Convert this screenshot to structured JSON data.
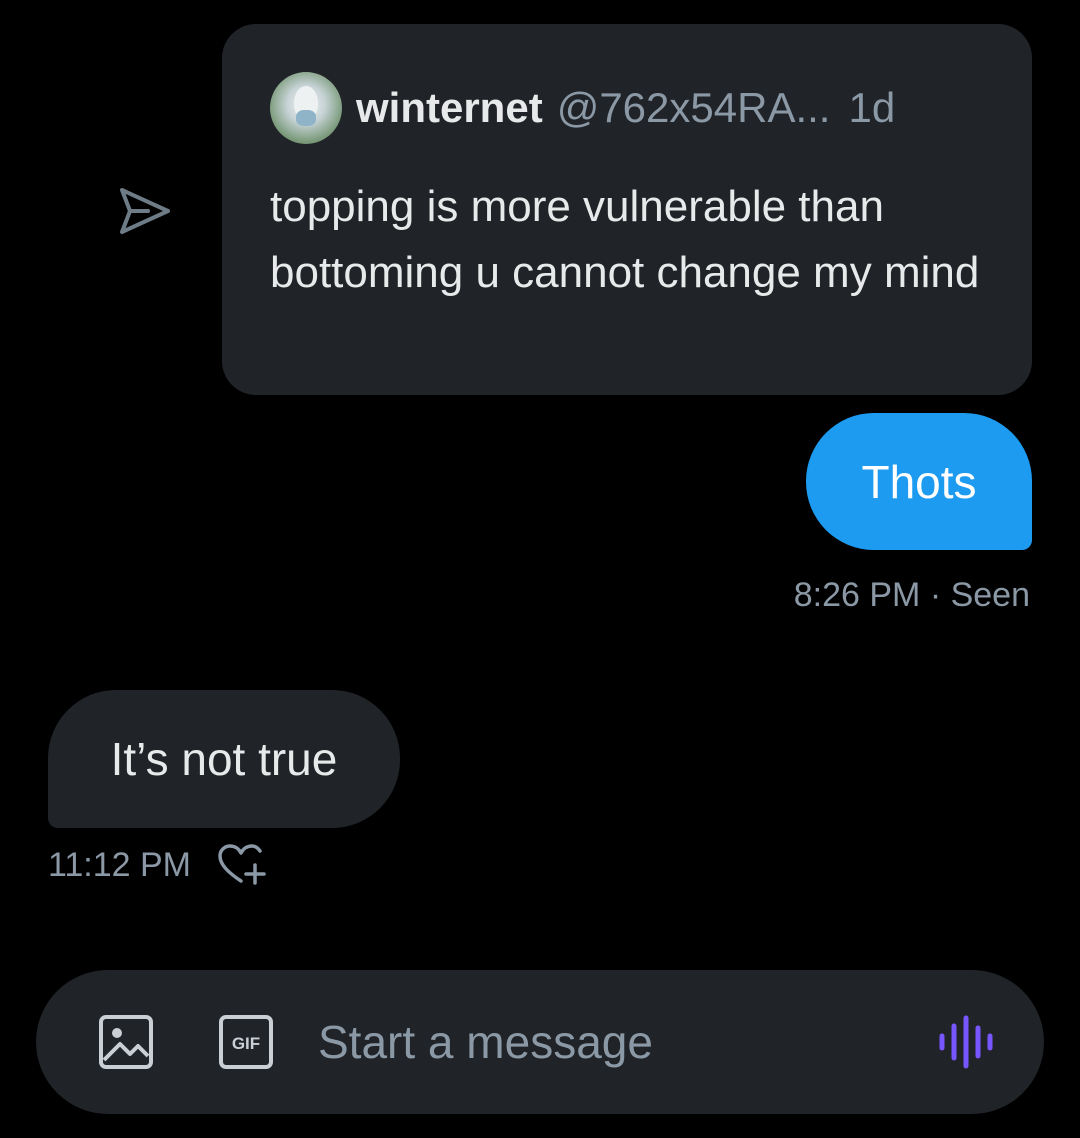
{
  "shared_tweet": {
    "author_name": "winternet",
    "author_handle": "@762x54RA...",
    "time_ago": "1d",
    "text": "topping is more vulnerable than bottoming u cannot change my mind"
  },
  "messages": [
    {
      "direction": "sent",
      "text": "Thots",
      "meta": "8:26 PM · Seen"
    },
    {
      "direction": "received",
      "text": "It’s not true",
      "meta": "11:12 PM"
    }
  ],
  "composer": {
    "placeholder": "Start a message",
    "gif_label": "GIF"
  },
  "icons": {
    "share": "share-arrow-icon",
    "react": "add-reaction-heart-icon",
    "image": "image-icon",
    "gif": "gif-icon",
    "voice": "voice-wave-icon"
  },
  "colors": {
    "background": "#000000",
    "card": "#202327",
    "accent_blue": "#1d9bf0",
    "muted_text": "#8b98a5",
    "voice_purple": "#7856ff"
  }
}
